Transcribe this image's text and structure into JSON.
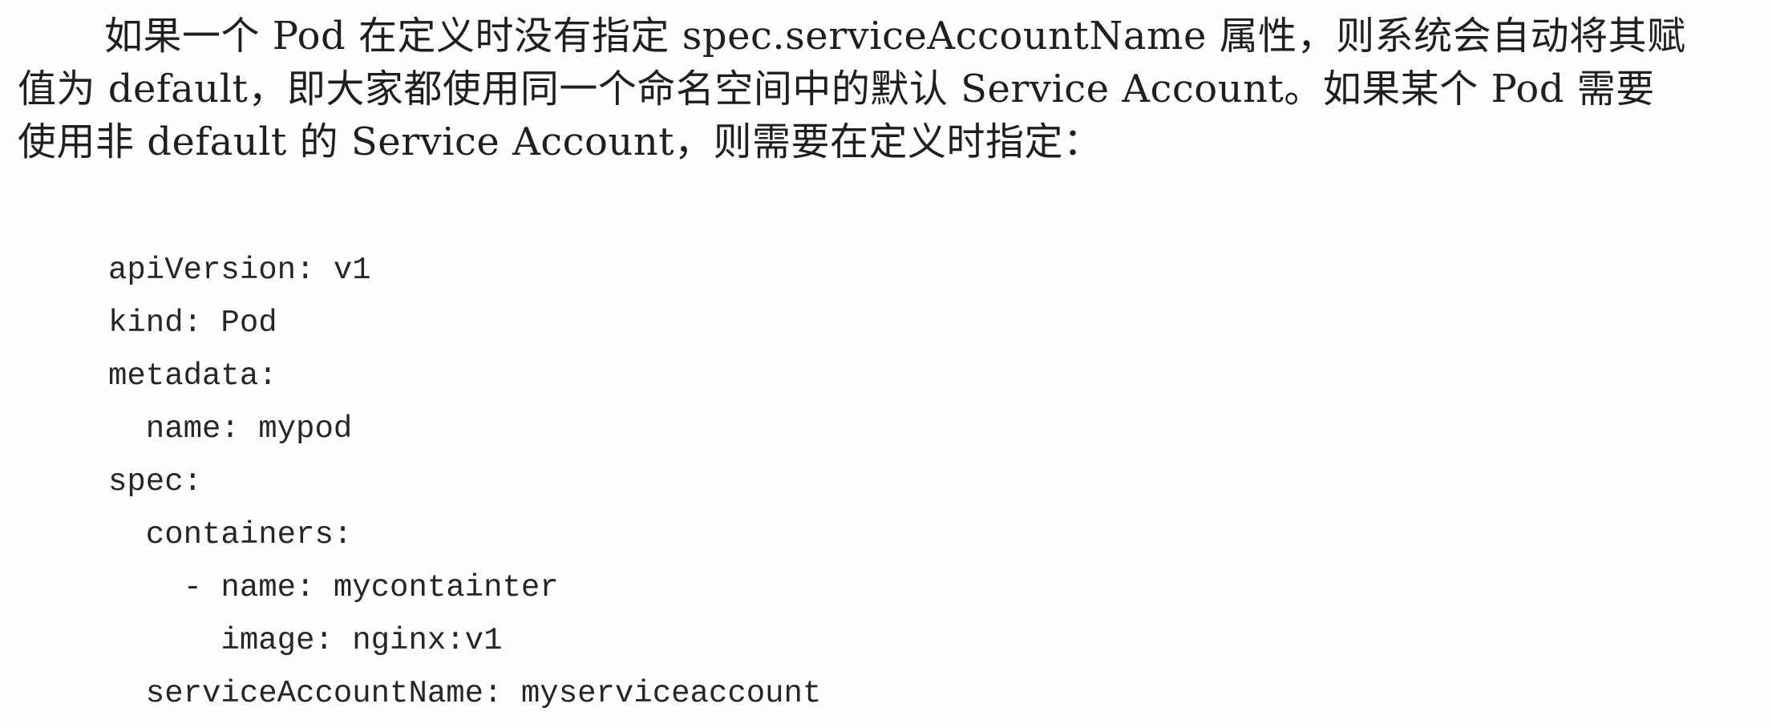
{
  "paragraph": {
    "lines": [
      "如果一个 Pod 在定义时没有指定 spec.serviceAccountName 属性，则系统会自动将其赋",
      "值为 default，即大家都使用同一个命名空间中的默认 Service Account。如果某个 Pod 需要",
      "使用非 default 的 Service Account，则需要在定义时指定："
    ]
  },
  "code": {
    "lines": [
      "apiVersion: v1",
      "kind: Pod",
      "metadata:",
      "  name: mypod",
      "spec:",
      "  containers:",
      "    - name: mycontainter",
      "      image: nginx:v1",
      "  serviceAccountName: myserviceaccount"
    ]
  }
}
